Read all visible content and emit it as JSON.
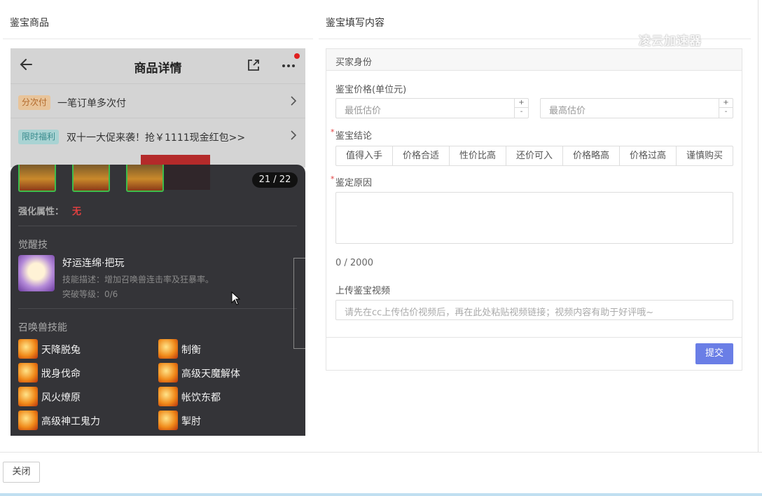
{
  "left_header": "鉴宝商品",
  "right_header": "鉴宝填写内容",
  "watermark": "凌云加速器",
  "phone": {
    "title": "商品详情",
    "promo_rows": [
      {
        "tag": "分次付",
        "text": "一笔订单多次付"
      },
      {
        "tag": "限时福利",
        "text": "双十一大促来袭！抢￥1111现金红包>>"
      }
    ],
    "image_counter": "21 / 22",
    "enhance_label": "强化属性：",
    "enhance_value": "无",
    "awaken_title": "觉醒技",
    "awaken_skill": {
      "name": "好运连绵·把玩",
      "desc": "技能描述：增加召唤兽连击率及狂暴率。",
      "level": "突破等级：0/6"
    },
    "summon_title": "召唤兽技能",
    "skills": [
      "天降脱兔",
      "制衡",
      "戕身伐命",
      "高级天魔解体",
      "风火燎原",
      "帐饮东都",
      "高级神工鬼力",
      "掣肘"
    ]
  },
  "form": {
    "section_title": "买家身份",
    "price_label": "鉴宝价格(单位元)",
    "min_placeholder": "最低估价",
    "max_placeholder": "最高估价",
    "stepper_plus": "+",
    "stepper_minus": "-",
    "conclusion_label": "鉴宝结论",
    "conclusion_options": [
      "值得入手",
      "价格合适",
      "性价比高",
      "还价可入",
      "价格略高",
      "价格过高",
      "谨慎购买"
    ],
    "reason_label": "鉴定原因",
    "char_count": "0 / 2000",
    "video_label": "上传鉴宝视频",
    "video_placeholder": "请先在cc上传估价视频后，再在此处粘贴视频链接；视频内容有助于好评哦~",
    "submit_label": "提交",
    "required_mark": "*"
  },
  "close_label": "关闭",
  "colors": {
    "accent": "#6a7ee6",
    "danger": "#e04040",
    "thumb_border": "#3dbd4c"
  }
}
